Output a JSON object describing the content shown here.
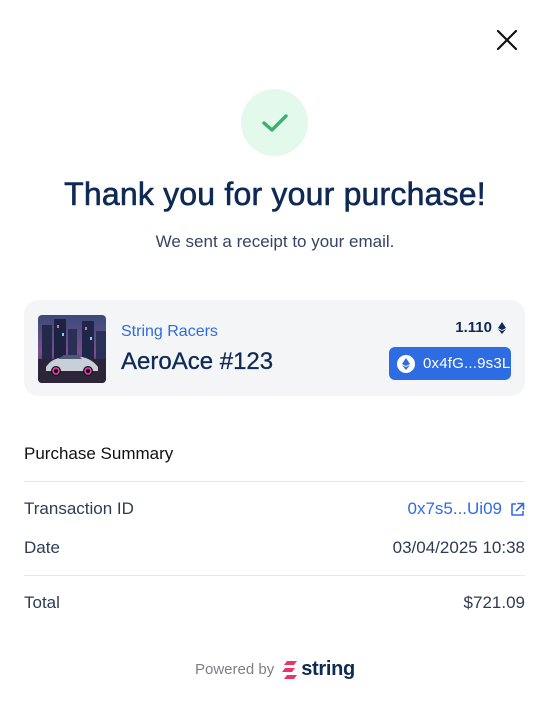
{
  "modal": {
    "title": "Thank you for your purchase!",
    "subtitle": "We sent a receipt to your email.",
    "close_icon": "close-icon",
    "success_icon": "checkmark-icon"
  },
  "nft": {
    "collection": "String Racers",
    "name": "AeroAce #123",
    "price": "1.110",
    "currency_icon": "ethereum-icon",
    "owner_address": "0x4fG...9s3L"
  },
  "summary": {
    "heading": "Purchase Summary",
    "rows": [
      {
        "label": "Transaction ID",
        "value": "0x7s5...Ui09",
        "icon": "external-link-icon"
      },
      {
        "label": "Date",
        "value": "03/04/2025 10:38"
      }
    ],
    "total": {
      "label": "Total",
      "value": "$721.09"
    }
  },
  "footer": {
    "powered_by": "Powered by",
    "brand": "string"
  },
  "colors": {
    "accent": "#2e6ce4",
    "success": "#3bb26a",
    "success_bg": "#e3f9ec",
    "brand_pink": "#e8366b",
    "title": "#0e2a54"
  }
}
